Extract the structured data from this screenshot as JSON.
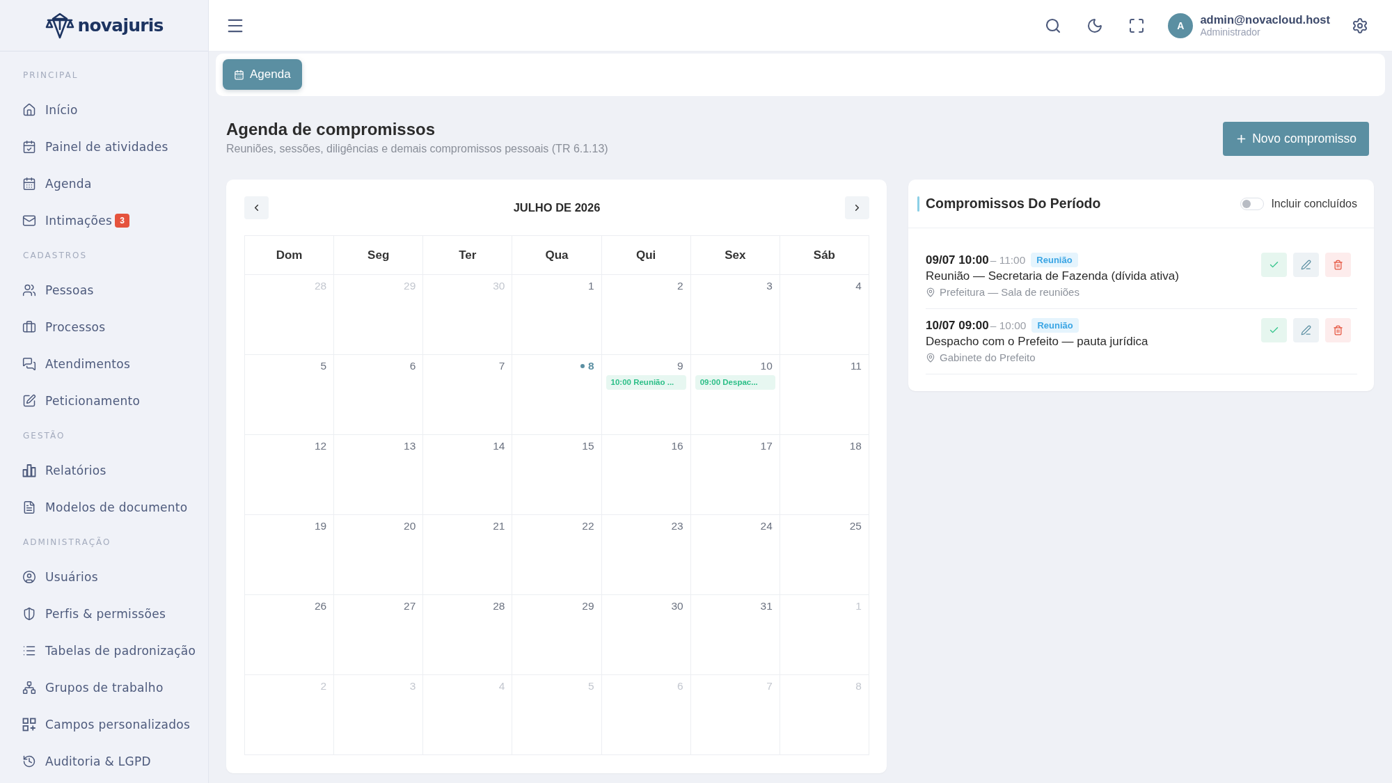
{
  "sidebar": {
    "brand": "novajuris",
    "sections": [
      {
        "title": "PRINCIPAL",
        "items": [
          {
            "label": "Início"
          },
          {
            "label": "Painel de atividades"
          },
          {
            "label": "Agenda"
          },
          {
            "label": "Intimações",
            "badge": "3"
          }
        ]
      },
      {
        "title": "CADASTROS",
        "items": [
          {
            "label": "Pessoas"
          },
          {
            "label": "Processos"
          },
          {
            "label": "Atendimentos"
          },
          {
            "label": "Peticionamento"
          }
        ]
      },
      {
        "title": "GESTÃO",
        "items": [
          {
            "label": "Relatórios"
          },
          {
            "label": "Modelos de documento"
          }
        ]
      },
      {
        "title": "ADMINISTRAÇÃO",
        "items": [
          {
            "label": "Usuários"
          },
          {
            "label": "Perfis & permissões"
          },
          {
            "label": "Tabelas de padronização"
          },
          {
            "label": "Grupos de trabalho"
          },
          {
            "label": "Campos personalizados"
          },
          {
            "label": "Auditoria & LGPD"
          }
        ]
      }
    ]
  },
  "header": {
    "user": {
      "initial": "A",
      "email": "admin@novacloud.host",
      "role": "Administrador"
    }
  },
  "tabs": [
    {
      "label": "Agenda",
      "selected": true
    }
  ],
  "page": {
    "title": "Agenda de compromissos",
    "subtitle": "Reuniões, sessões, diligências e demais compromissos pessoais (TR 6.1.13)",
    "new_button": "Novo compromisso"
  },
  "calendar": {
    "month": "JULHO DE 2026",
    "weekdays": [
      "Dom",
      "Seg",
      "Ter",
      "Qua",
      "Qui",
      "Sex",
      "Sáb"
    ],
    "weeks": [
      [
        {
          "day": "28",
          "outside": true,
          "today": false
        },
        {
          "day": "29",
          "outside": true,
          "today": false
        },
        {
          "day": "30",
          "outside": true,
          "today": false
        },
        {
          "day": "1",
          "outside": false,
          "today": false
        },
        {
          "day": "2",
          "outside": false,
          "today": false
        },
        {
          "day": "3",
          "outside": false,
          "today": false
        },
        {
          "day": "4",
          "outside": false,
          "today": false
        }
      ],
      [
        {
          "day": "5",
          "outside": false,
          "today": false
        },
        {
          "day": "6",
          "outside": false,
          "today": false
        },
        {
          "day": "7",
          "outside": false,
          "today": false
        },
        {
          "day": "8",
          "outside": false,
          "today": true
        },
        {
          "day": "9",
          "outside": false,
          "today": false,
          "events": [
            {
              "text": "10:00 Reunião ..."
            }
          ]
        },
        {
          "day": "10",
          "outside": false,
          "today": false,
          "events": [
            {
              "text": "09:00 Despac..."
            }
          ]
        },
        {
          "day": "11",
          "outside": false,
          "today": false
        }
      ],
      [
        {
          "day": "12",
          "outside": false,
          "today": false
        },
        {
          "day": "13",
          "outside": false,
          "today": false
        },
        {
          "day": "14",
          "outside": false,
          "today": false
        },
        {
          "day": "15",
          "outside": false,
          "today": false
        },
        {
          "day": "16",
          "outside": false,
          "today": false
        },
        {
          "day": "17",
          "outside": false,
          "today": false
        },
        {
          "day": "18",
          "outside": false,
          "today": false
        }
      ],
      [
        {
          "day": "19",
          "outside": false,
          "today": false
        },
        {
          "day": "20",
          "outside": false,
          "today": false
        },
        {
          "day": "21",
          "outside": false,
          "today": false
        },
        {
          "day": "22",
          "outside": false,
          "today": false
        },
        {
          "day": "23",
          "outside": false,
          "today": false
        },
        {
          "day": "24",
          "outside": false,
          "today": false
        },
        {
          "day": "25",
          "outside": false,
          "today": false
        }
      ],
      [
        {
          "day": "26",
          "outside": false,
          "today": false
        },
        {
          "day": "27",
          "outside": false,
          "today": false
        },
        {
          "day": "28",
          "outside": false,
          "today": false
        },
        {
          "day": "29",
          "outside": false,
          "today": false
        },
        {
          "day": "30",
          "outside": false,
          "today": false
        },
        {
          "day": "31",
          "outside": false,
          "today": false
        },
        {
          "day": "1",
          "outside": true,
          "today": false
        }
      ],
      [
        {
          "day": "2",
          "outside": true,
          "today": false
        },
        {
          "day": "3",
          "outside": true,
          "today": false
        },
        {
          "day": "4",
          "outside": true,
          "today": false
        },
        {
          "day": "5",
          "outside": true,
          "today": false
        },
        {
          "day": "6",
          "outside": true,
          "today": false
        },
        {
          "day": "7",
          "outside": true,
          "today": false
        },
        {
          "day": "8",
          "outside": true,
          "today": false
        }
      ]
    ]
  },
  "period_panel": {
    "title": "Compromissos Do Período",
    "include_done": {
      "label": "Incluir concluídos",
      "on": false
    },
    "items": [
      {
        "start": "09/07 10:00",
        "end": "– 11:00",
        "type": "Reunião",
        "title": "Reunião — Secretaria de Fazenda (dívida ativa)",
        "location": "Prefeitura — Sala de reuniões"
      },
      {
        "start": "10/07 09:00",
        "end": "– 10:00",
        "type": "Reunião",
        "title": "Despacho com o Prefeito — pauta jurídica",
        "location": "Gabinete do Prefeito"
      }
    ]
  }
}
